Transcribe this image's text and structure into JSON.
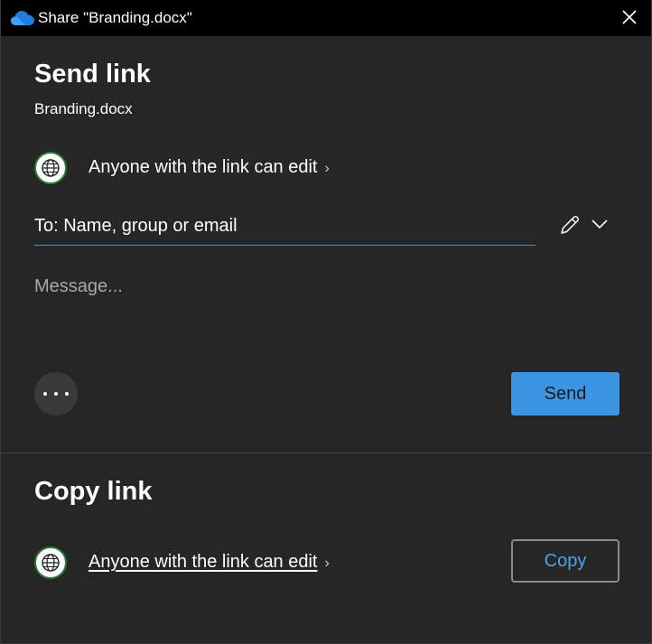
{
  "window": {
    "title": "Share \"Branding.docx\"",
    "colors": {
      "background": "#262626",
      "titlebar": "#000000",
      "accent": "#3b95e3",
      "link_text": "#4ea3ea"
    }
  },
  "send_link": {
    "heading": "Send link",
    "filename": "Branding.docx",
    "permission": "Anyone with the link can edit",
    "to_placeholder": "To: Name, group or email",
    "message_placeholder": "Message...",
    "send_label": "Send"
  },
  "copy_link": {
    "heading": "Copy link",
    "permission": "Anyone with the link can edit",
    "copy_label": "Copy"
  },
  "icons": {
    "app": "onedrive-cloud-icon",
    "close": "close-icon",
    "globe": "globe-icon",
    "chevron": "chevron-right-icon",
    "pencil": "pencil-icon",
    "dropdown": "chevron-down-icon",
    "more": "more-options-icon"
  },
  "glyphs": {
    "chevron": "›"
  }
}
